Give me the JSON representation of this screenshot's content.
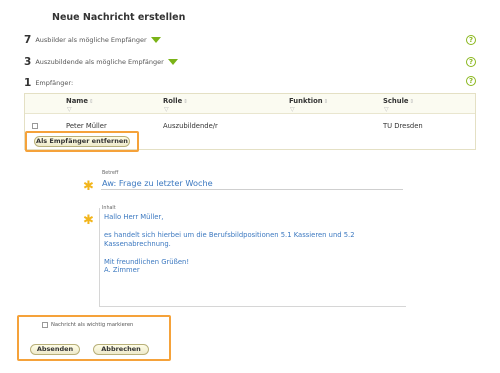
{
  "page": {
    "title": "Neue Nachricht erstellen"
  },
  "recipients": [
    {
      "count": "7",
      "label": "Ausbilder als mögliche Empfänger",
      "help": "?"
    },
    {
      "count": "3",
      "label": "Auszubildende als mögliche Empfänger",
      "help": "?"
    },
    {
      "count": "1",
      "label": "Empfänger:",
      "help": "?"
    }
  ],
  "table": {
    "columns": [
      {
        "label": "Name",
        "sort": "⇕",
        "filter": "▽"
      },
      {
        "label": "Rolle",
        "sort": "⇕",
        "filter": "▽"
      },
      {
        "label": "Funktion",
        "sort": "⇕",
        "filter": "▽"
      },
      {
        "label": "Schule",
        "sort": "⇕",
        "filter": "▽"
      }
    ],
    "rows": [
      {
        "name": "Peter Müller",
        "rolle": "Auszubildende/r",
        "funktion": "",
        "schule": "TU Dresden"
      }
    ],
    "remove_button": "Als Empfänger entfernen"
  },
  "form": {
    "subject_label": "Betreff",
    "subject_value": "Aw: Frage zu letzter Woche",
    "content_label": "Inhalt",
    "content_lines": [
      "Hallo Herr Müller,",
      "",
      "es handelt sich hierbei um die Berufsbildpositionen 5.1 Kassieren und 5.2",
      "Kassenabrechnung.",
      "",
      "Mit freundlichen Grüßen!",
      "A. Zimmer"
    ],
    "required_marker": "✱"
  },
  "footer": {
    "important_label": "Nachricht als wichtig markieren",
    "send_button": "Absenden",
    "cancel_button": "Abbrechen"
  },
  "colors": {
    "accent_green": "#7ab317",
    "link_blue": "#3b78c0",
    "highlight_orange": "#f5a23a",
    "star_yellow": "#f2b51c"
  }
}
